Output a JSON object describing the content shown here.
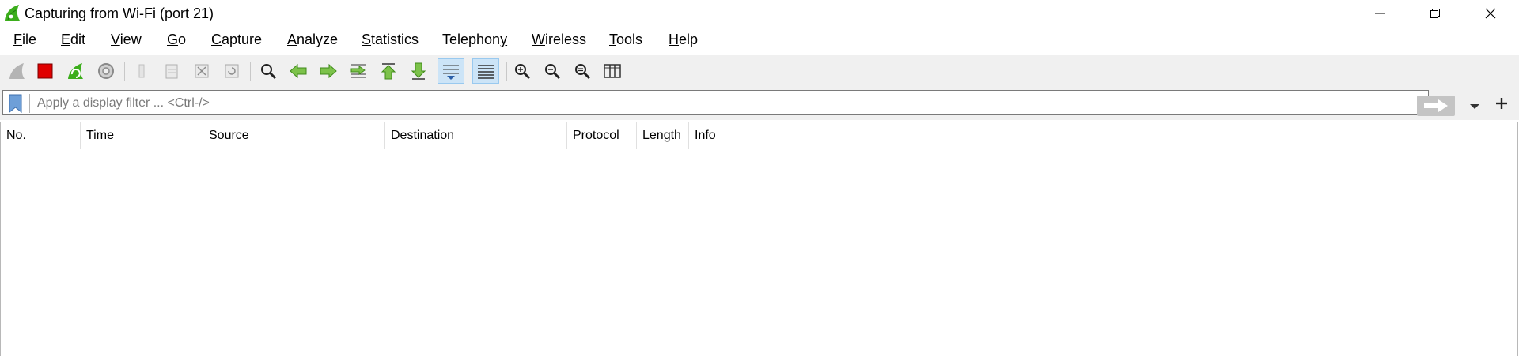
{
  "window": {
    "title": "Capturing from Wi-Fi (port 21)",
    "controls": [
      "minimize",
      "restore",
      "close"
    ]
  },
  "menubar": {
    "items": [
      {
        "mnemonic": "F",
        "rest": "ile"
      },
      {
        "mnemonic": "E",
        "rest": "dit"
      },
      {
        "mnemonic": "V",
        "rest": "iew"
      },
      {
        "mnemonic": "G",
        "rest": "o"
      },
      {
        "mnemonic": "C",
        "rest": "apture"
      },
      {
        "mnemonic": "A",
        "rest": "nalyze"
      },
      {
        "mnemonic": "S",
        "rest": "tatistics"
      },
      {
        "mnemonic": "",
        "rest": "Telephony",
        "pre": "Telephon",
        "mn2": "y"
      },
      {
        "mnemonic": "W",
        "rest": "ireless"
      },
      {
        "mnemonic": "T",
        "rest": "ools"
      },
      {
        "mnemonic": "H",
        "rest": "elp"
      }
    ]
  },
  "toolbar": {
    "icons": [
      "start-capture-icon",
      "stop-capture-icon",
      "restart-capture-icon",
      "capture-options-icon",
      "open-file-icon",
      "save-file-icon",
      "close-file-icon",
      "reload-file-icon",
      "find-packet-icon",
      "go-back-icon",
      "go-forward-icon",
      "go-to-packet-icon",
      "go-first-packet-icon",
      "go-last-packet-icon",
      "autoscroll-icon",
      "colorize-icon",
      "zoom-in-icon",
      "zoom-out-icon",
      "normal-size-icon",
      "resize-columns-icon"
    ]
  },
  "filter": {
    "placeholder": "Apply a display filter ... <Ctrl-/>",
    "value": ""
  },
  "packet_list": {
    "columns": [
      "No.",
      "Time",
      "Source",
      "Destination",
      "Protocol",
      "Length",
      "Info"
    ],
    "rows": []
  },
  "colors": {
    "toolbar_bg": "#f0f0f0",
    "active_button_bg": "#cce4f7",
    "shark_green": "#3cae1c",
    "stop_red": "#e00000",
    "bookmark_blue": "#6e9fd8"
  }
}
